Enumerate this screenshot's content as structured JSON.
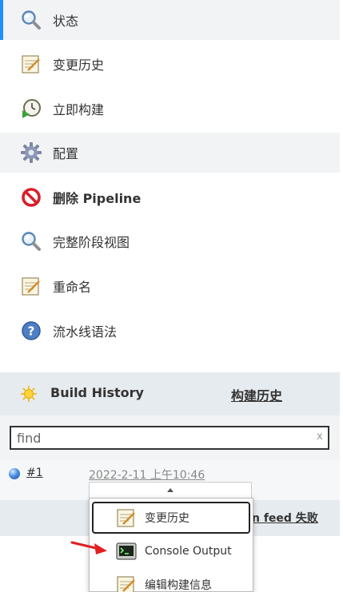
{
  "sidebar": {
    "items": [
      {
        "label": "状态",
        "icon": "magnifier-icon"
      },
      {
        "label": "变更历史",
        "icon": "notepad-icon"
      },
      {
        "label": "立即构建",
        "icon": "clock-build-icon"
      },
      {
        "label": "配置",
        "icon": "gear-icon"
      },
      {
        "label": "删除 Pipeline",
        "icon": "no-entry-icon"
      },
      {
        "label": "完整阶段视图",
        "icon": "magnifier-icon"
      },
      {
        "label": "重命名",
        "icon": "notepad-icon"
      },
      {
        "label": "流水线语法",
        "icon": "help-icon"
      }
    ]
  },
  "build_history": {
    "title": "Build History",
    "trend_link": "构建历史",
    "search": {
      "value": "find",
      "clear": "x"
    },
    "builds": [
      {
        "number": "#1",
        "date": "2022-2-11 上午10:46"
      }
    ],
    "feed_text": "n feed 失败"
  },
  "context_menu": {
    "items": [
      {
        "label": "变更历史",
        "icon": "notepad-icon"
      },
      {
        "label": "Console Output",
        "icon": "terminal-icon"
      },
      {
        "label": "编辑构建信息",
        "icon": "notepad-icon"
      }
    ]
  },
  "colors": {
    "accent": "#1e90ff",
    "arrow": "#e02020",
    "header_bg": "#e6ebef"
  }
}
